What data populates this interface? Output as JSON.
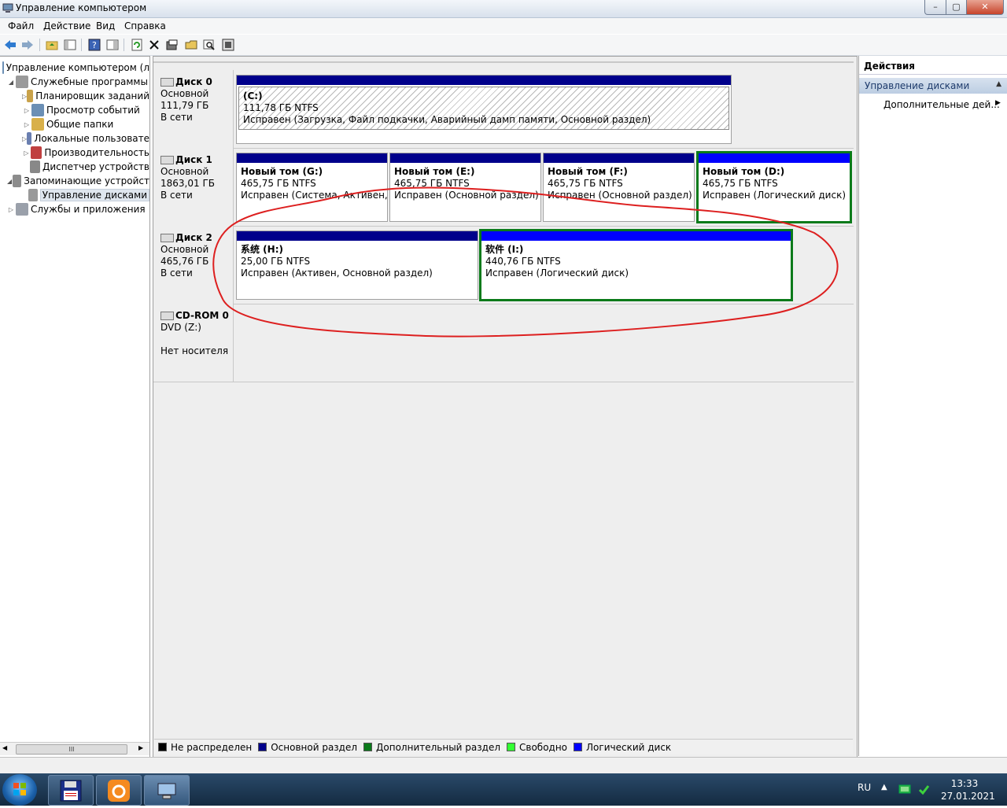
{
  "window": {
    "title": "Управление компьютером",
    "min": "–",
    "max": "▢",
    "close": "✕"
  },
  "menu": [
    "Файл",
    "Действие",
    "Вид",
    "Справка"
  ],
  "toolbar_icons": [
    "back-arrow-icon",
    "forward-arrow-icon",
    "up-folder-icon",
    "show-hide-tree-icon",
    "help-icon",
    "properties-icon",
    "refresh-icon",
    "delete-icon",
    "export-icon",
    "open-icon",
    "search-icon",
    "settings-icon"
  ],
  "tree": [
    {
      "label": "Управление компьютером (л",
      "level": 0,
      "arrow": "",
      "icon": "computer-management-icon"
    },
    {
      "label": "Служебные программы",
      "level": 1,
      "arrow": "◢",
      "icon": "tools-icon"
    },
    {
      "label": "Планировщик заданий",
      "level": 2,
      "arrow": "▷",
      "icon": "clock-icon"
    },
    {
      "label": "Просмотр событий",
      "level": 2,
      "arrow": "▷",
      "icon": "event-viewer-icon"
    },
    {
      "label": "Общие папки",
      "level": 2,
      "arrow": "▷",
      "icon": "shared-folders-icon"
    },
    {
      "label": "Локальные пользовате",
      "level": 2,
      "arrow": "▷",
      "icon": "users-icon"
    },
    {
      "label": "Производительность",
      "level": 2,
      "arrow": "▷",
      "icon": "performance-icon"
    },
    {
      "label": "Диспетчер устройств",
      "level": 2,
      "arrow": "",
      "icon": "device-manager-icon"
    },
    {
      "label": "Запоминающие устройст",
      "level": 1,
      "arrow": "◢",
      "icon": "storage-icon"
    },
    {
      "label": "Управление дисками",
      "level": 2,
      "arrow": "",
      "icon": "disk-management-icon",
      "selected": true
    },
    {
      "label": "Службы и приложения",
      "level": 1,
      "arrow": "▷",
      "icon": "services-icon"
    }
  ],
  "tree_scroll_thumb": "III",
  "disks": [
    {
      "name": "Диск 0",
      "type": "Основной",
      "size": "111,79 ГБ",
      "status": "В сети",
      "partitions": [
        {
          "name": "(C:)",
          "size": "111,78 ГБ NTFS",
          "status": "Исправен (Загрузка, Файл подкачки, Аварийный дамп памяти, Основной раздел)"
        }
      ]
    },
    {
      "name": "Диск 1",
      "type": "Основной",
      "size": "1863,01 ГБ",
      "status": "В сети",
      "partitions": [
        {
          "name": "Новый том  (G:)",
          "size": "465,75 ГБ NTFS",
          "status": "Исправен (Система, Активен, Ос"
        },
        {
          "name": "Новый том  (E:)",
          "size": "465,75 ГБ NTFS",
          "status": "Исправен (Основной раздел)"
        },
        {
          "name": "Новый том  (F:)",
          "size": "465,75 ГБ NTFS",
          "status": "Исправен (Основной раздел)"
        },
        {
          "name": "Новый том  (D:)",
          "size": "465,75 ГБ NTFS",
          "status": "Исправен (Логический диск)"
        }
      ]
    },
    {
      "name": "Диск 2",
      "type": "Основной",
      "size": "465,76 ГБ",
      "status": "В сети",
      "partitions": [
        {
          "name": "系统  (H:)",
          "size": "25,00 ГБ NTFS",
          "status": "Исправен (Активен, Основной раздел)"
        },
        {
          "name": "软件  (I:)",
          "size": "440,76 ГБ NTFS",
          "status": "Исправен (Логический диск)"
        }
      ]
    },
    {
      "name": "CD-ROM 0",
      "type": "DVD (Z:)",
      "size": "",
      "status": "Нет носителя"
    }
  ],
  "legend": [
    {
      "label": "Не распределен",
      "color": "#000000"
    },
    {
      "label": "Основной раздел",
      "color": "#00008b"
    },
    {
      "label": "Дополнительный раздел",
      "color": "#0a7a1a"
    },
    {
      "label": "Свободно",
      "color": "#33ff33"
    },
    {
      "label": "Логический диск",
      "color": "#0000ff"
    }
  ],
  "actions": {
    "header": "Действия",
    "section": "Управление дисками",
    "more": "Дополнительные дей...",
    "collapse_glyph": "▲",
    "more_glyph": "▶"
  },
  "taskbar": {
    "lang": "RU",
    "tray_up": "▲",
    "time": "13:33",
    "date": "27.01.2021"
  },
  "colors": {
    "primary_partition": "#00008b",
    "logical_disk": "#0000ff",
    "extended_border": "#0a7a1a",
    "annotation": "#dd1f1f"
  }
}
